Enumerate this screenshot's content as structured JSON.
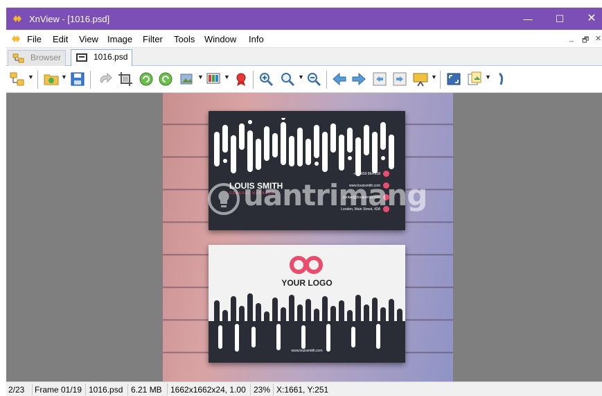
{
  "window": {
    "title": "XnView - [1016.psd]",
    "minimize": "—",
    "maximize": "☐",
    "close": "✕"
  },
  "menu": {
    "items": [
      "File",
      "Edit",
      "View",
      "Image",
      "Filter",
      "Tools",
      "Window",
      "Info"
    ],
    "mdi_min": "_",
    "mdi_restore": "🗗",
    "mdi_close": "✕"
  },
  "tabs": [
    {
      "label": "Browser",
      "icon": "browser-icon",
      "active": false
    },
    {
      "label": "1016.psd",
      "icon": "image-tab-icon",
      "active": true
    }
  ],
  "toolbar": {
    "icons": [
      "browser-icon",
      "open-folder-icon",
      "save-icon",
      "undo-icon",
      "crop-icon",
      "rotate-left-icon",
      "rotate-right-icon",
      "adjust-image-icon",
      "color-icon",
      "effects-icon",
      "zoom-in-icon",
      "zoom-icon",
      "zoom-out-icon",
      "previous-icon",
      "next-icon",
      "previous-page-icon",
      "next-page-icon",
      "slideshow-icon",
      "fit-screen-icon",
      "copy-to-icon",
      "more-icon"
    ]
  },
  "image": {
    "card_name": "LOUIS SMITH",
    "card_role": "GENERAL MANAGER",
    "contacts": [
      "+008659 864 258",
      "www.louissmith.com",
      "contact@louissmith.com",
      "London, Main Street, 42A"
    ],
    "logo_text": "YOUR LOGO",
    "back_url": "www.louissmith.com",
    "watermark": "uantrimang",
    "colors": {
      "accent": "#e84d6d",
      "card_dark": "#2a2d36"
    }
  },
  "status": {
    "index": "2/23",
    "frame": "Frame 01/19",
    "filename": "1016.psd",
    "filesize": "6.21 MB",
    "dimensions": "1662x1662x24, 1.00",
    "zoom": "23%",
    "cursor": "X:1661, Y:251"
  }
}
